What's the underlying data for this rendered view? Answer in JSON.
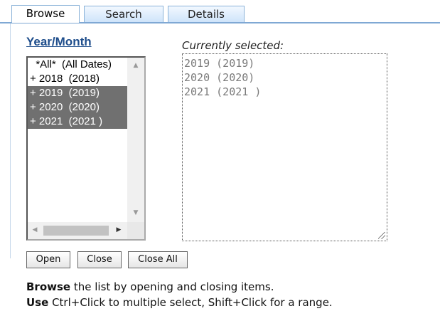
{
  "tabs": [
    {
      "label": "Browse",
      "active": true
    },
    {
      "label": "Search",
      "active": false
    },
    {
      "label": "Details",
      "active": false
    }
  ],
  "year_month": {
    "heading": "Year/Month",
    "items": [
      {
        "label": "  *All*  (All Dates)",
        "selected": false
      },
      {
        "label": "+ 2018  (2018)",
        "selected": false
      },
      {
        "label": "+ 2019  (2019)",
        "selected": true
      },
      {
        "label": "+ 2020  (2020)",
        "selected": true
      },
      {
        "label": "+ 2021  (2021 )",
        "selected": true
      }
    ]
  },
  "currently_selected": {
    "label": "Currently selected:",
    "lines": [
      "2019 (2019)",
      "2020 (2020)",
      "2021 (2021 )"
    ]
  },
  "buttons": {
    "open": "Open",
    "close": "Close",
    "close_all": "Close All"
  },
  "help": {
    "line1_bold": "Browse",
    "line1_rest": " the list by opening and closing items.",
    "line2_bold": "Use",
    "line2_rest": " Ctrl+Click to multiple select, Shift+Click for a range."
  },
  "colors": {
    "tab_border": "#8ab2d8",
    "heading": "#1f4e8c",
    "selected_bg": "#707070"
  }
}
